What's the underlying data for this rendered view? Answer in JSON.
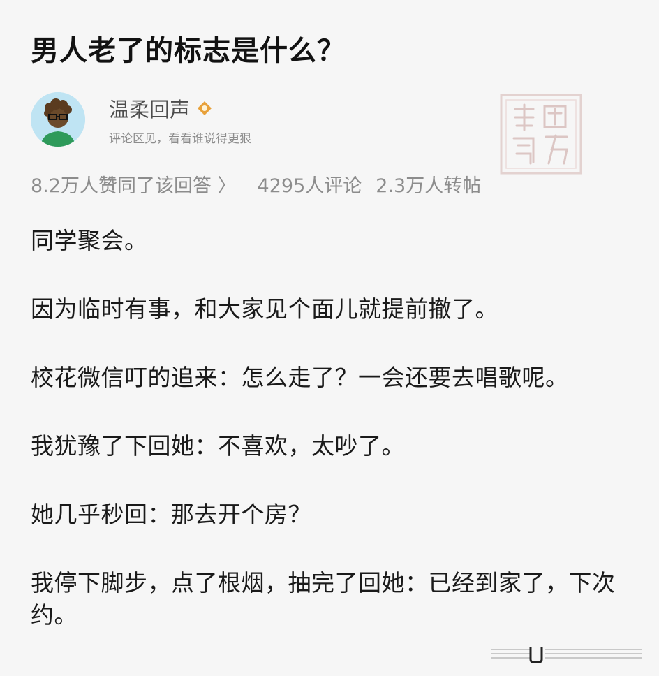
{
  "question": {
    "title": "男人老了的标志是什么？"
  },
  "author": {
    "name": "温柔回声",
    "bio": "评论区见，看看谁说得更狠",
    "badge_icon": "badge-icon",
    "avatar_icon": "avatar-cartoon-man"
  },
  "stats": {
    "likes": "8.2万人赞同了该回答 〉",
    "comments": "4295人评论",
    "reposts": "2.3万人转帖"
  },
  "answer": {
    "paragraphs": [
      "同学聚会。",
      "因为临时有事，和大家见个面儿就提前撤了。",
      "校花微信叮的追来：怎么走了？一会还要去唱歌呢。",
      "我犹豫了下回她：不喜欢，太吵了。",
      "她几乎秒回：那去开个房？",
      "我停下脚步，点了根烟，抽完了回她：已经到家了，下次约。"
    ]
  },
  "colors": {
    "background": "#f6f6f6",
    "title": "#121212",
    "meta_gray": "#8c8c8c",
    "avatar_bg": "#bfe4f3",
    "badge": "#e8a13a"
  }
}
